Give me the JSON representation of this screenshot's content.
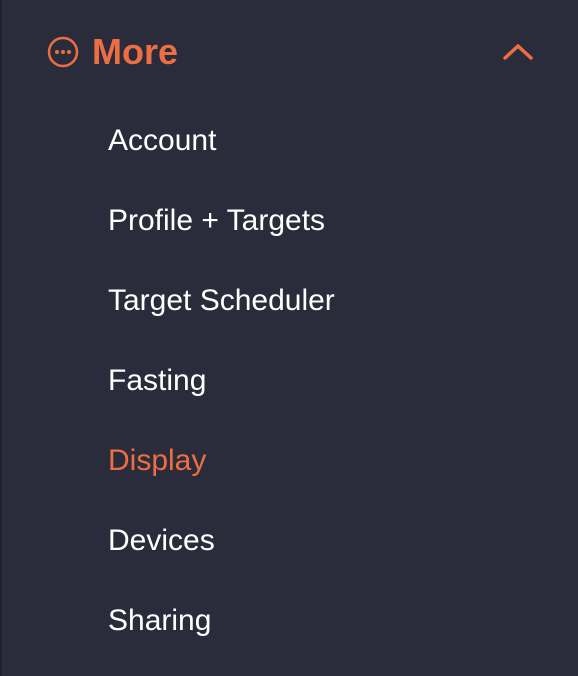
{
  "header": {
    "label": "More",
    "icon": "more-dots-icon",
    "expanded_icon": "chevron-up-icon",
    "accent_color": "#ec6f44"
  },
  "items": [
    {
      "label": "Account",
      "active": false
    },
    {
      "label": "Profile + Targets",
      "active": false
    },
    {
      "label": "Target Scheduler",
      "active": false
    },
    {
      "label": "Fasting",
      "active": false
    },
    {
      "label": "Display",
      "active": true
    },
    {
      "label": "Devices",
      "active": false
    },
    {
      "label": "Sharing",
      "active": false
    }
  ],
  "colors": {
    "background": "#2b2c3b",
    "text": "#ffffff",
    "active": "#ec6f44"
  }
}
